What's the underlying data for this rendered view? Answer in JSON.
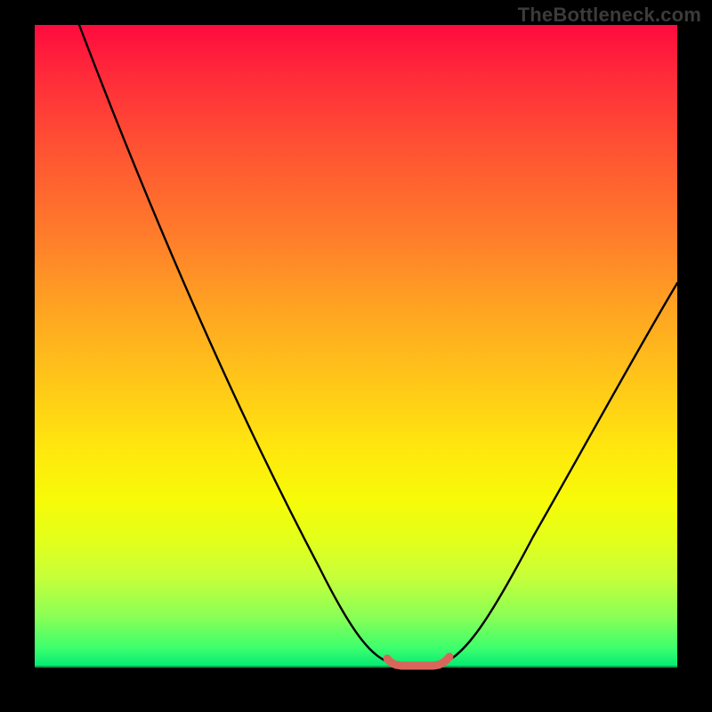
{
  "watermark": "TheBottleneck.com",
  "chart_data": {
    "type": "line",
    "title": "",
    "xlabel": "",
    "ylabel": "",
    "xlim": [
      0,
      100
    ],
    "ylim": [
      0,
      100
    ],
    "grid": false,
    "legend": false,
    "description": "Bottleneck percentage curve over a red-yellow-green heat gradient. Minimum (valley) corresponds to balanced hardware; rising sides indicate CPU or GPU bottleneck severity.",
    "series": [
      {
        "name": "bottleneck-curve-main",
        "color": "#000000",
        "x": [
          7,
          15,
          25,
          35,
          45,
          52,
          55,
          57,
          62,
          65,
          67,
          72,
          80,
          90,
          100
        ],
        "y": [
          100,
          84,
          64,
          44,
          24,
          8,
          2,
          0,
          0,
          0,
          2,
          10,
          26,
          46,
          64
        ]
      },
      {
        "name": "valley-highlight",
        "color": "#d9655b",
        "x": [
          55,
          57,
          62,
          65,
          67
        ],
        "y": [
          2,
          0,
          0,
          0,
          2
        ]
      }
    ],
    "gradient_stops": [
      {
        "pos": 0.0,
        "color": "#ff0b3e"
      },
      {
        "pos": 0.2,
        "color": "#ff5532"
      },
      {
        "pos": 0.44,
        "color": "#ffa322"
      },
      {
        "pos": 0.66,
        "color": "#ffe70e"
      },
      {
        "pos": 0.86,
        "color": "#c6ff3a"
      },
      {
        "pos": 1.0,
        "color": "#00e874"
      }
    ]
  }
}
